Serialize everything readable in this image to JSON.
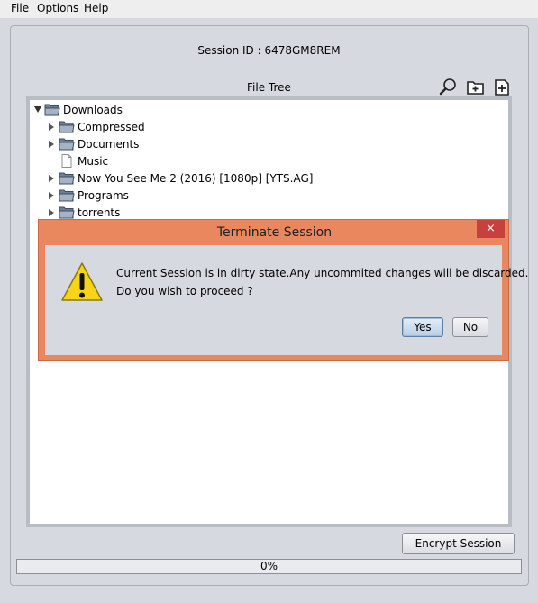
{
  "menu": {
    "file": "File",
    "options": "Options",
    "help": "Help"
  },
  "session": {
    "id_text": "Session ID : 6478GM8REM"
  },
  "file_tree": {
    "label": "File Tree",
    "root": "Downloads",
    "items": [
      {
        "label": "Compressed",
        "type": "folder",
        "expandable": true
      },
      {
        "label": "Documents",
        "type": "folder",
        "expandable": true
      },
      {
        "label": "Music",
        "type": "file",
        "expandable": false
      },
      {
        "label": "Now You See Me 2 (2016) [1080p] [YTS.AG]",
        "type": "folder",
        "expandable": true
      },
      {
        "label": "Programs",
        "type": "folder",
        "expandable": true
      },
      {
        "label": "torrents",
        "type": "folder",
        "expandable": true
      }
    ],
    "toolbar_icons": [
      "search-icon",
      "new-folder-icon",
      "new-file-icon"
    ]
  },
  "dialog": {
    "title": "Terminate Session",
    "close": "×",
    "message_line1": "Current Session is in dirty state.Any uncommited changes will be discarded.",
    "message_line2": "Do you wish to proceed ?",
    "yes": "Yes",
    "no": "No",
    "colors": {
      "titlebar": "#e9875f",
      "close": "#c7413c"
    }
  },
  "footer": {
    "encrypt_button": "Encrypt Session",
    "progress_text": "0%",
    "progress_value": 0
  }
}
